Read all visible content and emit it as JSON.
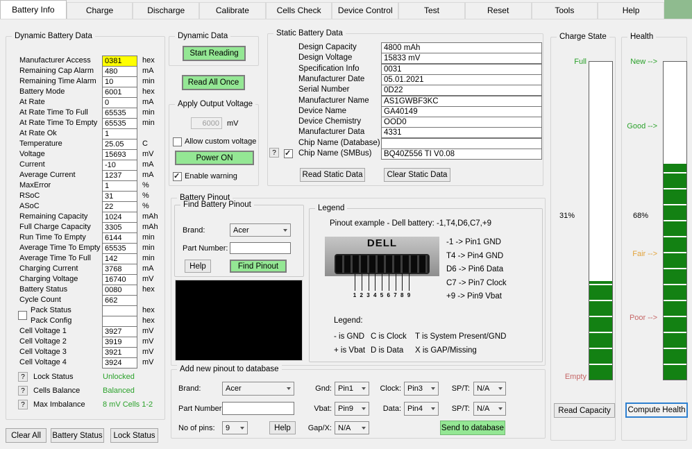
{
  "tabs": {
    "items": [
      {
        "label": "Battery Info",
        "active": true
      },
      {
        "label": "Charge",
        "active": false
      },
      {
        "label": "Discharge",
        "active": false
      },
      {
        "label": "Calibrate",
        "active": false
      },
      {
        "label": "Cells Check",
        "active": false
      },
      {
        "label": "Device Control",
        "active": false
      },
      {
        "label": "Test",
        "active": false
      },
      {
        "label": "Reset",
        "active": false
      },
      {
        "label": "Tools",
        "active": false
      },
      {
        "label": "Help",
        "active": false
      }
    ]
  },
  "dynamic": {
    "title": "Dynamic Battery Data",
    "help_glyph": "?",
    "rows": [
      {
        "label": "Manufacturer Access",
        "value": "0381",
        "unit": "hex",
        "highlight": true
      },
      {
        "label": "Remaining Cap Alarm",
        "value": "480",
        "unit": "mA"
      },
      {
        "label": "Remaining Time Alarm",
        "value": "10",
        "unit": "min"
      },
      {
        "label": "Battery Mode",
        "value": "6001",
        "unit": "hex"
      },
      {
        "label": "At Rate",
        "value": "0",
        "unit": "mA"
      },
      {
        "label": "At Rate Time To Full",
        "value": "65535",
        "unit": "min"
      },
      {
        "label": "At Rate Time To Empty",
        "value": "65535",
        "unit": "min"
      },
      {
        "label": "At Rate Ok",
        "value": "1",
        "unit": ""
      },
      {
        "label": "Temperature",
        "value": "25.05",
        "unit": "C"
      },
      {
        "label": "Voltage",
        "value": "15693",
        "unit": "mV"
      },
      {
        "label": "Current",
        "value": "-10",
        "unit": "mA"
      },
      {
        "label": "Average Current",
        "value": "1237",
        "unit": "mA"
      },
      {
        "label": "MaxError",
        "value": "1",
        "unit": "%"
      },
      {
        "label": "RSoC",
        "value": "31",
        "unit": "%"
      },
      {
        "label": "ASoC",
        "value": "22",
        "unit": "%"
      },
      {
        "label": "Remaining Capacity",
        "value": "1024",
        "unit": "mAh"
      },
      {
        "label": "Full Charge Capacity",
        "value": "3305",
        "unit": "mAh"
      },
      {
        "label": "Run Time To Empty",
        "value": "6144",
        "unit": "min"
      },
      {
        "label": "Average Time To Empty",
        "value": "65535",
        "unit": "min"
      },
      {
        "label": "Average Time To Full",
        "value": "142",
        "unit": "min"
      },
      {
        "label": "Charging Current",
        "value": "3768",
        "unit": "mA"
      },
      {
        "label": "Charging Voltage",
        "value": "16740",
        "unit": "mV"
      },
      {
        "label": "Battery Status",
        "value": "0080",
        "unit": "hex"
      },
      {
        "label": "Cycle Count",
        "value": "662",
        "unit": ""
      },
      {
        "label": "Pack Status",
        "value": "",
        "unit": "hex",
        "indent": true
      },
      {
        "label": "Pack Config",
        "value": "",
        "unit": "hex",
        "indent": true
      },
      {
        "label": "Cell Voltage 1",
        "value": "3927",
        "unit": "mV"
      },
      {
        "label": "Cell Voltage 2",
        "value": "3919",
        "unit": "mV"
      },
      {
        "label": "Cell Voltage 3",
        "value": "3921",
        "unit": "mV"
      },
      {
        "label": "Cell Voltage 4",
        "value": "3924",
        "unit": "mV"
      }
    ],
    "status": [
      {
        "label": "Lock Status",
        "value": "Unlocked"
      },
      {
        "label": "Cells Balance",
        "value": "Balanced"
      },
      {
        "label": "Max Imbalance",
        "value": "8 mV Cells 1-2"
      }
    ],
    "buttons": {
      "clear_all": "Clear All",
      "battery_status": "Battery Status",
      "lock_status": "Lock Status"
    }
  },
  "dynamic_data": {
    "title": "Dynamic Data",
    "start_reading": "Start Reading",
    "read_all_once": "Read All Once"
  },
  "apply_output": {
    "title": "Apply Output Voltage",
    "voltage_value": "6000",
    "voltage_unit": "mV",
    "allow_custom": "Allow custom voltage",
    "power_on": "Power ON",
    "enable_warning": "Enable warning"
  },
  "static": {
    "title": "Static Battery Data",
    "help_glyph": "?",
    "rows": [
      {
        "label": "Design Capacity",
        "value": "4800 mAh"
      },
      {
        "label": "Design Voltage",
        "value": "15833 mV"
      },
      {
        "label": "Specification Info",
        "value": "0031"
      },
      {
        "label": "Manufacturer Date",
        "value": "05.01.2021"
      },
      {
        "label": "Serial Number",
        "value": "0D22"
      },
      {
        "label": "Manufacturer Name",
        "value": "AS1GWBF3KC"
      },
      {
        "label": "Device Name",
        "value": "GA40149"
      },
      {
        "label": "Device Chemistry",
        "value": "OOD0"
      },
      {
        "label": "Manufacturer Data",
        "value": "4331"
      },
      {
        "label": "Chip Name (Database)",
        "value": ""
      },
      {
        "label": "Chip Name (SMBus)",
        "value": "BQ40Z556 TI V0.08"
      }
    ],
    "read_button": "Read Static Data",
    "clear_button": "Clear Static Data"
  },
  "pinout": {
    "title": "Battery Pinout",
    "find": {
      "title": "Find Battery Pinout",
      "brand_label": "Brand:",
      "brand_value": "Acer",
      "part_label": "Part Number:",
      "part_value": "",
      "help": "Help",
      "find_button": "Find Pinout"
    },
    "legend": {
      "title": "Legend",
      "example": "Pinout example - Dell battery:  -1,T4,D6,C7,+9",
      "connector_brand": "DELL",
      "pin_numbers": [
        "1",
        "2",
        "3",
        "4",
        "5",
        "6",
        "7",
        "8",
        "9"
      ],
      "mappings": [
        "-1 -> Pin1 GND",
        "T4 -> Pin4 GND",
        "D6 -> Pin6 Data",
        "C7 -> Pin7 Clock",
        "+9 -> Pin9 Vbat"
      ],
      "key_title": "Legend:",
      "key_row1": [
        "- is GND",
        "C is Clock",
        "T is System Present/GND"
      ],
      "key_row2": [
        "+ is Vbat",
        "D is Data",
        "X is GAP/Missing"
      ]
    }
  },
  "add_pinout": {
    "title": "Add new pinout to database",
    "brand_label": "Brand:",
    "brand_value": "Acer",
    "part_label": "Part Number:",
    "part_value": "",
    "pins_label": "No of pins:",
    "pins_value": "9",
    "help": "Help",
    "gnd_label": "Gnd:",
    "gnd_value": "Pin1",
    "clock_label": "Clock:",
    "clock_value": "Pin3",
    "spt1_label": "SP/T:",
    "spt1_value": "N/A",
    "vbat_label": "Vbat:",
    "vbat_value": "Pin9",
    "data_label": "Data:",
    "data_value": "Pin4",
    "spt2_label": "SP/T:",
    "spt2_value": "N/A",
    "gap_label": "Gap/X:",
    "gap_value": "N/A",
    "send_button": "Send to database"
  },
  "charge_state": {
    "title": "Charge State",
    "top_label": "Full",
    "bottom_label": "Empty",
    "percent": "31%",
    "percent_value": 31,
    "button": "Read Capacity"
  },
  "health": {
    "title": "Health",
    "label_new": "New -->",
    "label_good": "Good -->",
    "label_fair": "Fair -->",
    "label_poor": "Poor -->",
    "percent": "68%",
    "percent_value": 68,
    "button": "Compute Health"
  },
  "colors": {
    "tab_corner_green": "#8fbb8f",
    "button_green": "#94e794",
    "bar_green": "#138113",
    "good_text_green": "#2aa12a",
    "fair_orange": "#e2a33b",
    "poor_red": "#c56666",
    "highlight_yellow": "#ffff00",
    "focus_blue": "#2e80d0"
  }
}
